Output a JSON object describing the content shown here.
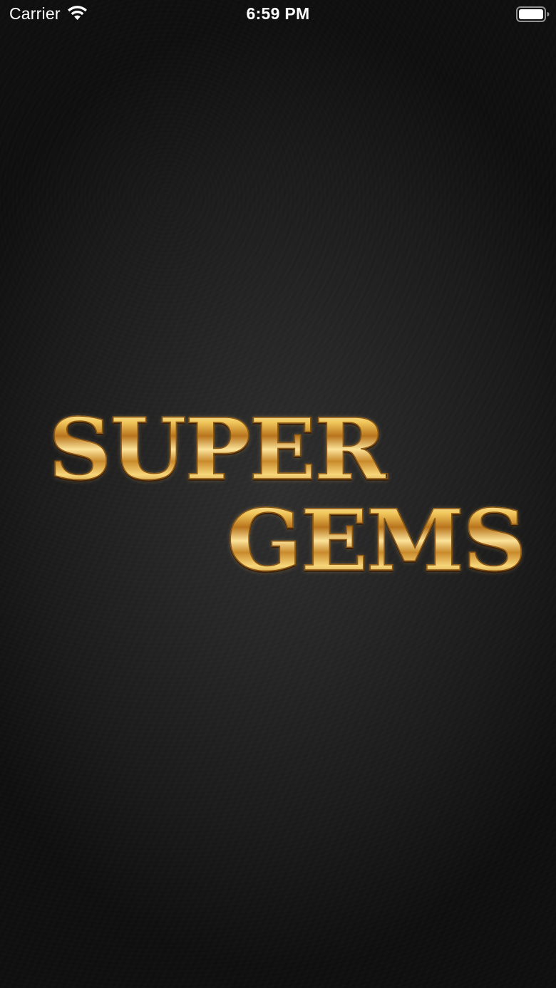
{
  "status_bar": {
    "carrier": "Carrier",
    "time": "6:59 PM",
    "wifi_icon": "wifi-icon",
    "battery_icon": "battery-icon"
  },
  "splash": {
    "logo_line1": "SUPER",
    "logo_line2": "GEMS"
  },
  "colors": {
    "background": "#252525",
    "gold": "#e8b84a",
    "gold_dark": "#8a5412",
    "status_text": "#ffffff"
  }
}
